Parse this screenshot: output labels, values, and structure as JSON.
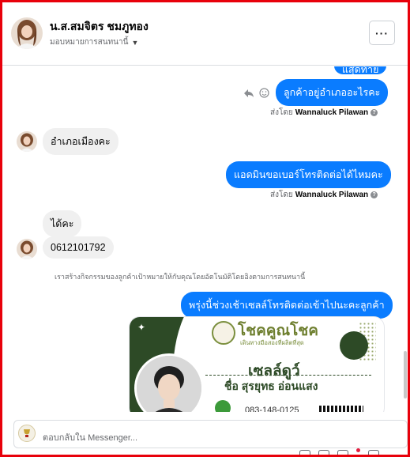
{
  "header": {
    "name": "น.ส.สมจิตร ชมภูทอง",
    "assign_label": "มอบหมายการสนทนานี้",
    "more_label": "···"
  },
  "messages": {
    "partial_top": "แสุดท้าย",
    "out_1": "ลูกค้าอยู่อำเภออะไรคะ",
    "sent_by_1": {
      "prefix": "ส่งโดย",
      "name": "Wannaluck Pilawan"
    },
    "in_1": "อำเภอเมืองคะ",
    "out_2": "แอดมินขอเบอร์โทรติดต่อได้ไหมคะ",
    "sent_by_2": {
      "prefix": "ส่งโดย",
      "name": "Wannaluck Pilawan"
    },
    "in_2": "ได้คะ",
    "in_3": "0612101792",
    "system_note": "เราสร้างกิจกรรมของลูกค้าเป้าหมายให้กับคุณโดยอัตโนมัติโดยอิงตามการสนทนานี้",
    "out_3": "พรุ่งนี้ช่วงเช้าเซลล์โทรติดต่อเข้าไปนะคะลูกค้า"
  },
  "card": {
    "brand": "โชคคูณโชค",
    "tagline": "เดินทางมือสองที่ผลิตที่สุด",
    "title": "เซลล์ดูว์",
    "person": "ชื่อ สุรยุทธ อ่อนแสง",
    "phone": "083-148-0125"
  },
  "composer": {
    "placeholder": "ตอบกลับใน Messenger..."
  },
  "colors": {
    "accent": "#0a7cff",
    "frame": "#e8000b",
    "card_green": "#2d4a26"
  }
}
